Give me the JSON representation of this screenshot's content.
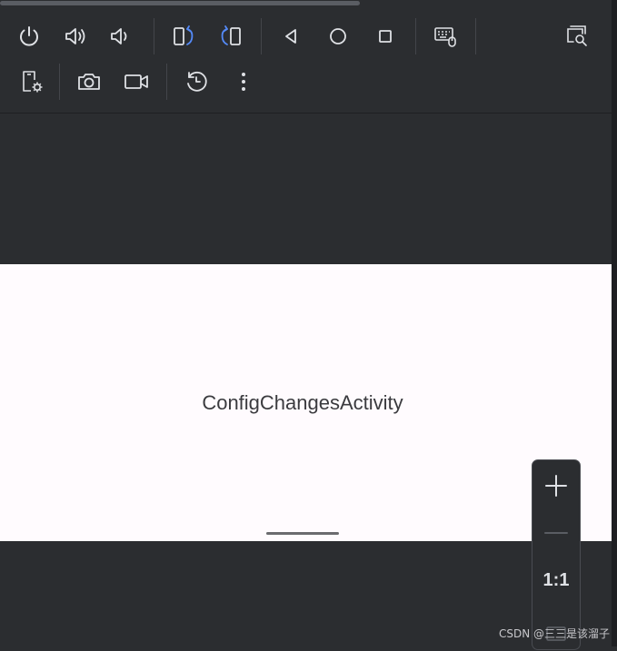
{
  "toolbar": {
    "row1": [
      {
        "name": "power-button",
        "icon": "power-icon"
      },
      {
        "name": "volume-up-button",
        "icon": "volume-up-icon"
      },
      {
        "name": "volume-down-button",
        "icon": "volume-down-icon"
      },
      {
        "name": "rotate-left-button",
        "icon": "rotate-left-icon"
      },
      {
        "name": "rotate-right-button",
        "icon": "rotate-right-icon"
      },
      {
        "name": "back-button",
        "icon": "triangle-back-icon"
      },
      {
        "name": "home-button",
        "icon": "circle-home-icon"
      },
      {
        "name": "overview-button",
        "icon": "square-overview-icon"
      },
      {
        "name": "keyboard-mouse-button",
        "icon": "keyboard-mouse-icon"
      },
      {
        "name": "inspect-button",
        "icon": "window-search-icon"
      }
    ],
    "row2": [
      {
        "name": "device-settings-button",
        "icon": "device-settings-icon"
      },
      {
        "name": "screenshot-button",
        "icon": "camera-icon"
      },
      {
        "name": "screen-record-button",
        "icon": "video-camera-icon"
      },
      {
        "name": "snapshot-button",
        "icon": "history-icon"
      },
      {
        "name": "more-button",
        "icon": "kebab-menu-icon"
      }
    ],
    "accent_color": "#548af7",
    "icon_color": "#dfe1e5"
  },
  "device": {
    "screen_text": "ConfigChangesActivity",
    "screen_background": "#fffbfe"
  },
  "zoom_controls": {
    "zoom_in_icon": "plus-icon",
    "zoom_out_icon": "minus-icon",
    "actual_size_label": "1:1",
    "fit_icon": "fit-screen-icon"
  },
  "watermark": "CSDN @三三是该溜子"
}
